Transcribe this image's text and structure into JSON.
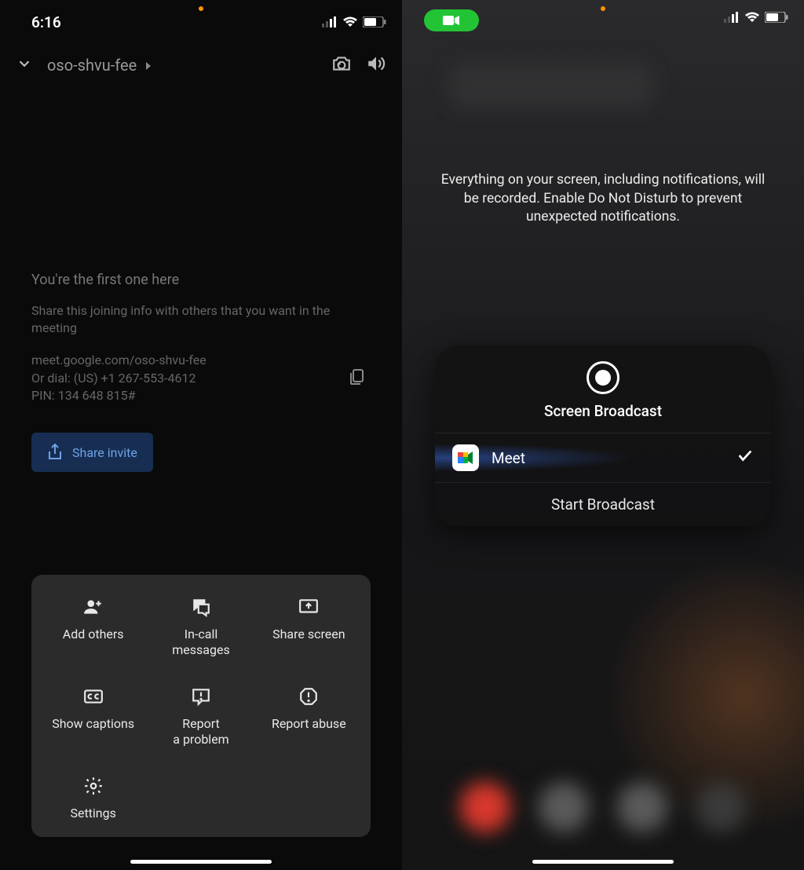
{
  "left": {
    "status": {
      "time": "6:16"
    },
    "header": {
      "meeting_code": "oso-shvu-fee"
    },
    "info": {
      "heading": "You're the first one here",
      "sub": "Share this joining info with others that you want in the meeting",
      "link": "meet.google.com/oso-shvu-fee",
      "dial": "Or dial: (US) +1 267-553-4612",
      "pin": "PIN: 134 648 815#"
    },
    "share_invite_label": "Share invite",
    "actions": {
      "add_others": "Add others",
      "in_call_messages": "In-call\nmessages",
      "share_screen": "Share screen",
      "show_captions": "Show captions",
      "report_problem": "Report\na problem",
      "report_abuse": "Report abuse",
      "settings": "Settings"
    }
  },
  "right": {
    "warning": "Everything on your screen, including notifications, will be recorded. Enable Do Not Disturb to prevent unexpected notifications.",
    "broadcast": {
      "title": "Screen Broadcast",
      "app_name": "Meet",
      "start_label": "Start Broadcast"
    }
  }
}
